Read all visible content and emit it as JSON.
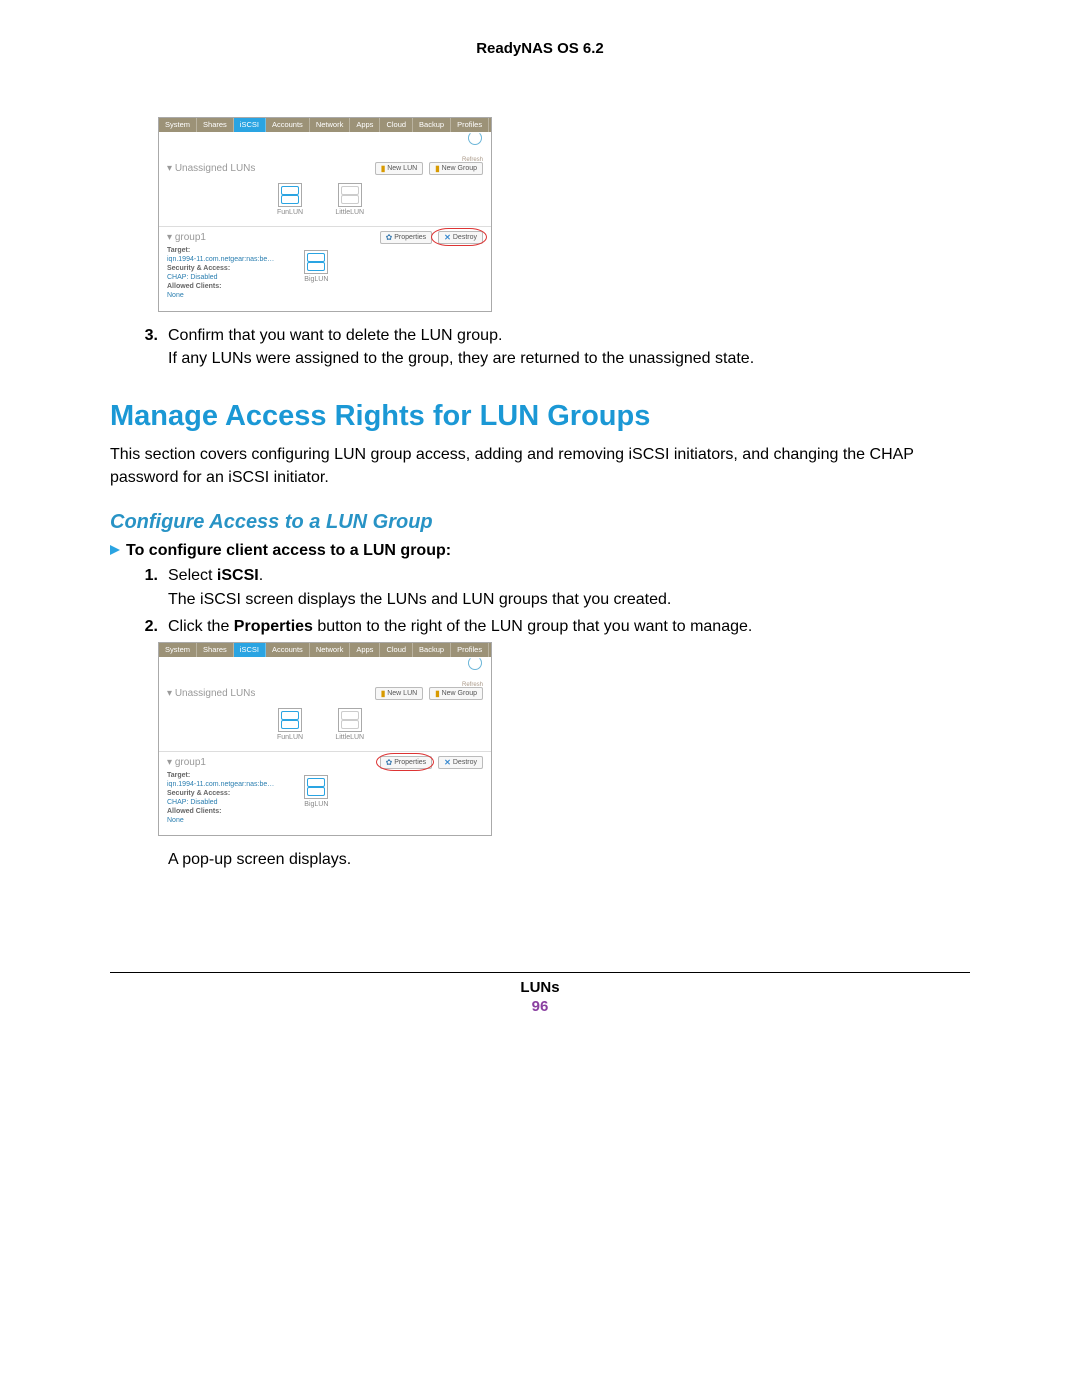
{
  "header": {
    "title": "ReadyNAS OS 6.2"
  },
  "screenshot": {
    "tabs": [
      "System",
      "Shares",
      "iSCSI",
      "Accounts",
      "Network",
      "Apps",
      "Cloud",
      "Backup",
      "Profiles"
    ],
    "active_tab": "iSCSI",
    "refresh_label": "Refresh",
    "unassigned_label": "Unassigned LUNs",
    "btn_new_lun": "New LUN",
    "btn_new_group": "New Group",
    "lun1": "FunLUN",
    "lun2": "LittleLUN",
    "group_name": "group1",
    "btn_properties": "Properties",
    "btn_destroy": "Destroy",
    "target_k": "Target:",
    "target_v": "iqn.1994-11.com.netgear:nas:be…",
    "sec_k": "Security & Access:",
    "sec_v": "CHAP: Disabled",
    "clients_k": "Allowed Clients:",
    "clients_v": "None",
    "grp_lun": "BigLUN"
  },
  "step3": {
    "num": "3.",
    "l1": "Confirm that you want to delete the LUN group.",
    "l2": "If any LUNs were assigned to the group, they are returned to the unassigned state."
  },
  "h2": "Manage Access Rights for LUN Groups",
  "intro": "This section covers configuring LUN group access, adding and removing iSCSI initiators, and changing the CHAP password for an iSCSI initiator.",
  "h3": "Configure Access to a LUN Group",
  "proc_title": "To configure client access to a LUN group:",
  "step1": {
    "num": "1.",
    "l1a": "Select ",
    "l1b": "iSCSI",
    "l1c": ".",
    "l2": "The iSCSI screen displays the LUNs and LUN groups that you created."
  },
  "step2": {
    "num": "2.",
    "l1a": "Click the ",
    "l1b": "Properties",
    "l1c": " button to the right of the LUN group that you want to manage."
  },
  "popup_line": "A pop-up screen displays.",
  "footer": {
    "label": "LUNs",
    "page": "96"
  }
}
